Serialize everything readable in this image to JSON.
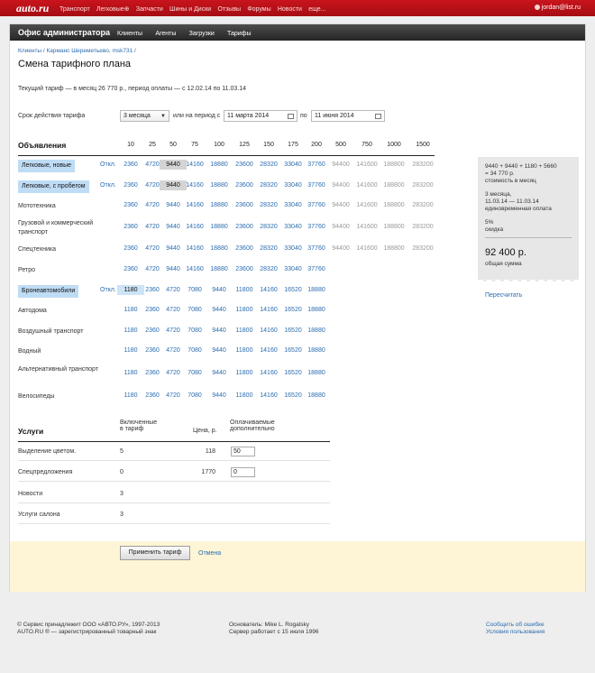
{
  "header": {
    "logo": "auto.ru",
    "nav": [
      "Транспорт",
      "Легковые⊕",
      "Запчасти",
      "Шины и Диски",
      "Отзывы",
      "Форумы",
      "Новости",
      "еще..."
    ],
    "user": "jordan@list.ru"
  },
  "admin": {
    "title": "Офис администратора",
    "nav": [
      "Клиенты",
      "Агенты",
      "Загрузки",
      "Тарифы"
    ]
  },
  "breadcrumb": "Клиенты / Карманс Шереметьево, msk731 /",
  "page_title": "Смена тарифного плана",
  "current_tariff": "Текущий тариф — в месяц 26 770 р., период оплаты — с 12.02.14 по 11.03.14",
  "period": {
    "label": "Срок действия тарифа",
    "select_value": "3 месяца",
    "or_text": "или на период с",
    "from": "11 марта 2014",
    "to_label": "по",
    "to": "11 июня 2014"
  },
  "ads": {
    "title": "Объявления",
    "off_label": "Откл.",
    "columns": [
      "10",
      "25",
      "50",
      "75",
      "100",
      "125",
      "150",
      "175",
      "200",
      "500",
      "750",
      "1000",
      "1500"
    ],
    "rows": [
      {
        "label": "Легковые, новые",
        "highlight": true,
        "off": true,
        "prices": [
          "2360",
          "4720",
          "9440",
          "14160",
          "18880",
          "23600",
          "28320",
          "33040",
          "37760",
          "94400",
          "141600",
          "188800",
          "283200"
        ],
        "selected": 2
      },
      {
        "label": "Легковые, с пробегом",
        "highlight": true,
        "off": true,
        "prices": [
          "2360",
          "4720",
          "9440",
          "14160",
          "18880",
          "23600",
          "28320",
          "33040",
          "37760",
          "94400",
          "141600",
          "188800",
          "283200"
        ],
        "selected": 2
      },
      {
        "label": "Мототехника",
        "prices": [
          "2360",
          "4720",
          "9440",
          "14160",
          "18880",
          "23600",
          "28320",
          "33040",
          "37760",
          "94400",
          "141600",
          "188800",
          "283200"
        ]
      },
      {
        "label": "Грузовой и коммерческий транспорт",
        "prices": [
          "2360",
          "4720",
          "9440",
          "14160",
          "18880",
          "23600",
          "28320",
          "33040",
          "37760",
          "94400",
          "141600",
          "188800",
          "283200"
        ]
      },
      {
        "label": "Спецтехника",
        "prices": [
          "2360",
          "4720",
          "9440",
          "14160",
          "18880",
          "23600",
          "28320",
          "33040",
          "37760",
          "94400",
          "141600",
          "188800",
          "283200"
        ]
      },
      {
        "label": "Ретро",
        "prices": [
          "2360",
          "4720",
          "9440",
          "14160",
          "18880",
          "23600",
          "28320",
          "33040",
          "37760"
        ]
      },
      {
        "label": "Бронеавтомобили",
        "highlight": true,
        "off": true,
        "prices": [
          "1180",
          "2360",
          "4720",
          "7080",
          "9440",
          "11800",
          "14160",
          "16520",
          "18880"
        ],
        "selected": 0
      },
      {
        "label": "Автодома",
        "prices": [
          "1180",
          "2360",
          "4720",
          "7080",
          "9440",
          "11800",
          "14160",
          "16520",
          "18880"
        ]
      },
      {
        "label": "Воздушный транспорт",
        "prices": [
          "1180",
          "2360",
          "4720",
          "7080",
          "9440",
          "11800",
          "14160",
          "16520",
          "18880"
        ]
      },
      {
        "label": "Водный",
        "prices": [
          "1180",
          "2360",
          "4720",
          "7080",
          "9440",
          "11800",
          "14160",
          "16520",
          "18880"
        ]
      },
      {
        "label": "Альтернативный транспорт",
        "prices": [
          "1180",
          "2360",
          "4720",
          "7080",
          "9440",
          "11800",
          "14160",
          "16520",
          "18880"
        ]
      },
      {
        "label": "Велосипеды",
        "prices": [
          "1180",
          "2360",
          "4720",
          "7080",
          "9440",
          "11800",
          "14160",
          "16520",
          "18880"
        ]
      }
    ]
  },
  "summary": {
    "formula": "9440 + 9440 + 1180 + 5660",
    "result": "= 34 770 р.",
    "monthly_label": "стоимость в месяц",
    "period": "3 месяца,",
    "dates": "11.03.14 — 11.03.14",
    "onetime_label": "единовременная оплата",
    "discount": "5%",
    "discount_label": "скидка",
    "total": "92 400 р.",
    "total_label": "общая сумма",
    "recalc": "Пересчитать"
  },
  "services": {
    "title": "Услуги",
    "col_included_1": "Включенные",
    "col_included_2": "в тариф",
    "col_price": "Цена, р.",
    "col_paid_1": "Оплачиваемые",
    "col_paid_2": "дополнительно",
    "rows": [
      {
        "label": "Выделение цветом.",
        "included": "5",
        "price": "118",
        "paid": "50"
      },
      {
        "label": "Спецпредложения",
        "included": "0",
        "price": "1770",
        "paid": "0"
      },
      {
        "label": "Новости",
        "included": "3"
      },
      {
        "label": "Услуги салона",
        "included": "3"
      }
    ]
  },
  "actions": {
    "apply": "Применить тариф",
    "cancel": "Отмена"
  },
  "footer": {
    "copyright": "© Сервис принадлежит ООО «АВТО.РУ», 1997-2013",
    "trademark": "AUTO.RU ® — зарегистрированный товарный знак",
    "founder": "Основатель: Mike L. Rogalsky",
    "uptime": "Сервер работает с 15 июля 1996",
    "report": "Сообщить об ошибке",
    "terms": "Условия пользования"
  }
}
